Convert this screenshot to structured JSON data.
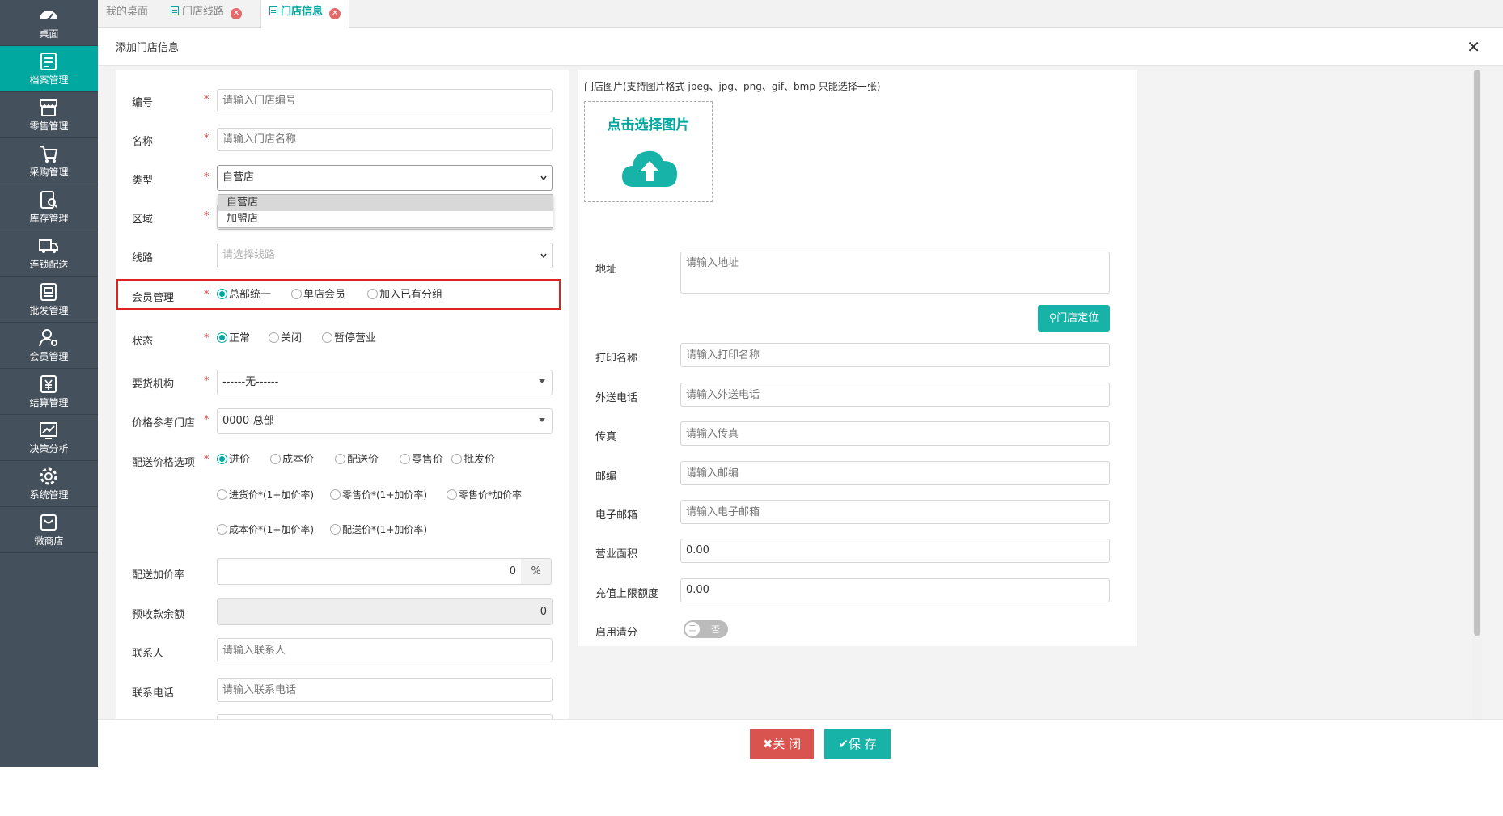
{
  "sidebar": {
    "items": [
      {
        "label": "桌面",
        "icon": "dashboard-icon"
      },
      {
        "label": "档案管理",
        "icon": "archive-icon"
      },
      {
        "label": "零售管理",
        "icon": "store-icon"
      },
      {
        "label": "采购管理",
        "icon": "cart-icon"
      },
      {
        "label": "库存管理",
        "icon": "inventory-icon"
      },
      {
        "label": "连锁配送",
        "icon": "truck-icon"
      },
      {
        "label": "批发管理",
        "icon": "wholesale-icon"
      },
      {
        "label": "会员管理",
        "icon": "member-icon"
      },
      {
        "label": "结算管理",
        "icon": "yen-icon"
      },
      {
        "label": "决策分析",
        "icon": "chart-icon"
      },
      {
        "label": "系统管理",
        "icon": "gear-icon"
      },
      {
        "label": "微商店",
        "icon": "bag-icon"
      }
    ],
    "active_index": 1,
    "active_color": "#00a8a0"
  },
  "tabs": [
    {
      "label": "我的桌面"
    },
    {
      "label": "门店线路"
    },
    {
      "label": "门店信息"
    }
  ],
  "modal": {
    "title": "添加门店信息",
    "close_glyph": "✕"
  },
  "form": {
    "code": {
      "label": "编号",
      "placeholder": "请输入门店编号",
      "required": "*"
    },
    "name": {
      "label": "名称",
      "placeholder": "请输入门店名称",
      "required": "*"
    },
    "type": {
      "label": "类型",
      "value": "自营店",
      "required": "*",
      "options": [
        "自营店",
        "加盟店"
      ]
    },
    "region": {
      "label": "区域",
      "required": "*"
    },
    "route": {
      "label": "线路",
      "placeholder": "请选择线路"
    },
    "member": {
      "label": "会员管理",
      "required": "*",
      "options": [
        "总部统一",
        "单店会员",
        "加入已有分组"
      ],
      "selected": 0
    },
    "status": {
      "label": "状态",
      "required": "*",
      "options": [
        "正常",
        "关闭",
        "暂停营业"
      ],
      "selected": 0
    },
    "supplier": {
      "label": "要货机构",
      "required": "*",
      "value": "------无------"
    },
    "price_ref": {
      "label": "价格参考门店",
      "required": "*",
      "value": "0000-总部"
    },
    "delivery_price": {
      "label": "配送价格选项",
      "required": "*",
      "options": [
        "进价",
        "成本价",
        "配送价",
        "零售价",
        "批发价",
        "进货价*(1+加价率)",
        "零售价*(1+加价率)",
        "零售价*加价率",
        "成本价*(1+加价率)",
        "配送价*(1+加价率)"
      ],
      "selected": 0
    },
    "markup": {
      "label": "配送加价率",
      "value": "0",
      "unit": "%"
    },
    "prepay": {
      "label": "预收款余额",
      "value": "0"
    },
    "contact": {
      "label": "联系人",
      "placeholder": "请输入联系人"
    },
    "phone": {
      "label": "联系电话",
      "placeholder": "请输入联系电话"
    }
  },
  "right": {
    "image_hint": "门店图片(支持图片格式 jpeg、jpg、png、gif、bmp 只能选择一张)",
    "upload_text": "点击选择图片",
    "address": {
      "label": "地址",
      "placeholder": "请输入地址"
    },
    "locate_button": "门店定位",
    "print_name": {
      "label": "打印名称",
      "placeholder": "请输入打印名称"
    },
    "delivery_phone": {
      "label": "外送电话",
      "placeholder": "请输入外送电话"
    },
    "fax": {
      "label": "传真",
      "placeholder": "请输入传真"
    },
    "zip": {
      "label": "邮编",
      "placeholder": "请输入邮编"
    },
    "email": {
      "label": "电子邮箱",
      "placeholder": "请输入电子邮箱"
    },
    "area": {
      "label": "营业面积",
      "value": "0.00"
    },
    "recharge_limit": {
      "label": "充值上限额度",
      "value": "0.00"
    },
    "points_clear": {
      "label": "启用清分",
      "knob": "三",
      "state": "否"
    }
  },
  "footer": {
    "close_button": "关 闭",
    "save_button": "保 存"
  }
}
